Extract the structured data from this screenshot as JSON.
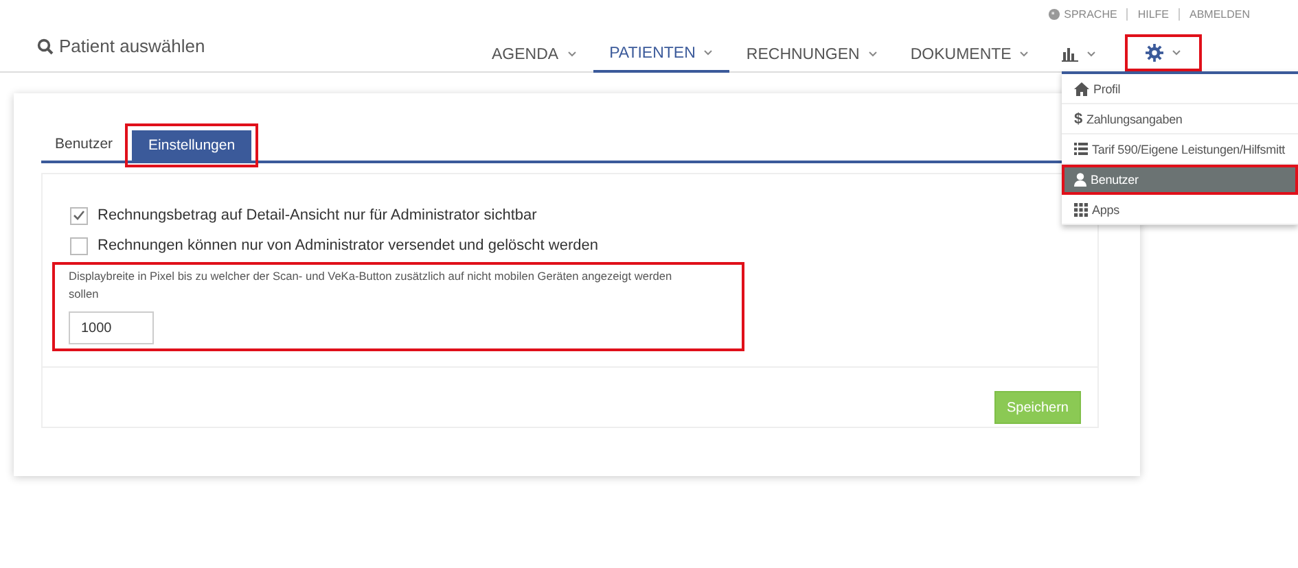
{
  "top_links": [
    {
      "label": "SPRACHE",
      "kind": "globe"
    },
    {
      "label": "HILFE",
      "kind": "plain"
    },
    {
      "label": "ABMELDEN",
      "kind": "plain"
    }
  ],
  "search": {
    "label": "Patient auswählen"
  },
  "nav": [
    {
      "kind": "text",
      "label": "AGENDA",
      "selected": false,
      "highlighted": false
    },
    {
      "kind": "text",
      "label": "PATIENTEN",
      "selected": true,
      "highlighted": false
    },
    {
      "kind": "text",
      "label": "RECHNUNGEN",
      "selected": false,
      "highlighted": false
    },
    {
      "kind": "text",
      "label": "DOKUMENTE",
      "selected": false,
      "highlighted": false
    },
    {
      "kind": "chart",
      "selected": false,
      "highlighted": false
    },
    {
      "kind": "gear",
      "selected": false,
      "highlighted": true
    }
  ],
  "dropdown": [
    {
      "kind": "home",
      "label": "Profil",
      "selected": false,
      "highlighted": false
    },
    {
      "kind": "dollar",
      "symbol": "$",
      "label": "Zahlungsangaben",
      "selected": false,
      "highlighted": false
    },
    {
      "kind": "list",
      "label": "Tarif 590/Eigene Leistungen/Hilfsmitt",
      "selected": false,
      "highlighted": false
    },
    {
      "kind": "user",
      "label": "Benutzer",
      "selected": true,
      "highlighted": true
    },
    {
      "kind": "grid",
      "label": "Apps",
      "selected": false,
      "highlighted": false
    }
  ],
  "tabs": [
    {
      "label": "Benutzer",
      "selected": false,
      "highlighted": false
    },
    {
      "label": "Einstellungen",
      "selected": true,
      "highlighted": true
    }
  ],
  "options": [
    {
      "label": "Rechnungsbetrag auf Detail-Ansicht nur für Administrator sichtbar",
      "checked": true
    },
    {
      "label": "Rechnungen können nur von Administrator versendet und gelöscht werden",
      "checked": false
    }
  ],
  "display_width": {
    "label": "Displaybreite in Pixel bis zu welcher der Scan- und VeKa-Button zusätzlich auf nicht mobilen Geräten angezeigt werden sollen",
    "value": "1000",
    "highlighted": true
  },
  "save_button": {
    "label": "Speichern"
  }
}
